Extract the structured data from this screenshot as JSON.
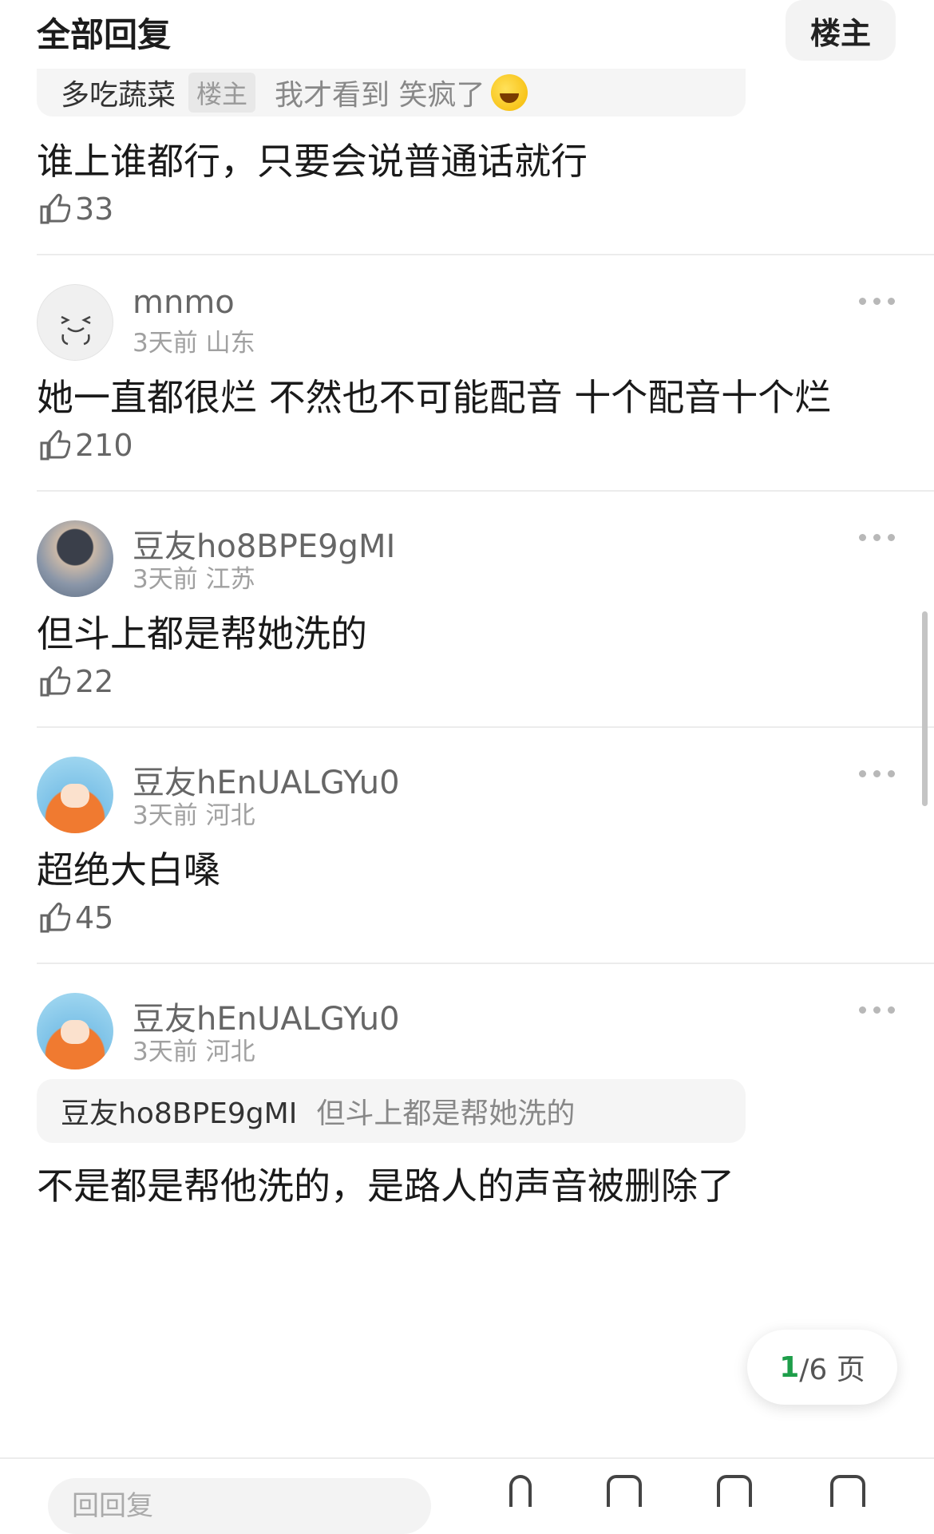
{
  "header": {
    "title": "全部回复",
    "louzhu_button": "楼主"
  },
  "comments": [
    {
      "quote": {
        "author": "多吃蔬菜",
        "tag": "楼主",
        "text": "我才看到 笑疯了"
      },
      "content": "谁上谁都行，只要会说普通话就行",
      "likes": "33"
    },
    {
      "username": "mnmo",
      "time": "3天前",
      "location": "山东",
      "content": "她一直都很烂 不然也不可能配音  十个配音十个烂",
      "likes": "210"
    },
    {
      "username": "豆友ho8BPE9gMI",
      "time": "3天前",
      "location": "江苏",
      "content": "但斗上都是帮她洗的",
      "likes": "22"
    },
    {
      "username": "豆友hEnUALGYu0",
      "time": "3天前",
      "location": "河北",
      "content": "超绝大白嗓",
      "likes": "45"
    },
    {
      "username": "豆友hEnUALGYu0",
      "time": "3天前",
      "location": "河北",
      "quote": {
        "author": "豆友ho8BPE9gMI",
        "text": "但斗上都是帮她洗的"
      },
      "content": "不是都是帮他洗的，是路人的声音被删除了"
    }
  ],
  "pager": {
    "current": "1",
    "total_text": "/6 页"
  },
  "bottom": {
    "reply_placeholder": "回回复"
  },
  "icons": {
    "like": "thumbs-up-icon",
    "more": "more-dots-icon",
    "emoji": "rolling-laugh-emoji"
  }
}
